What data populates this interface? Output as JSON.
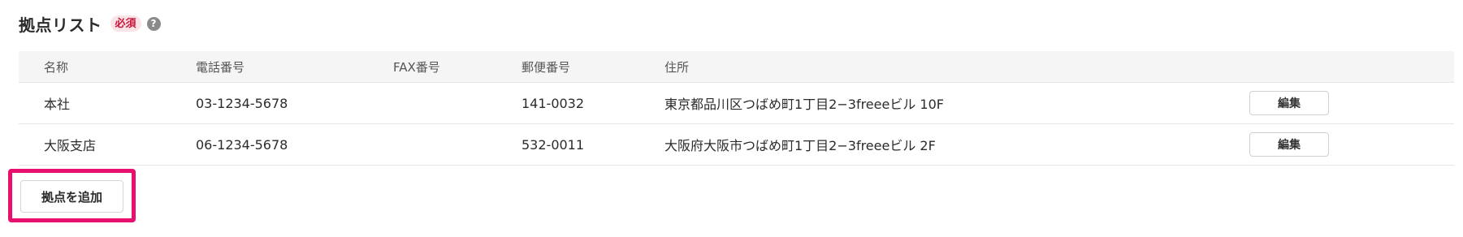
{
  "section": {
    "title": "拠点リスト",
    "required_badge": "必須",
    "help_icon": "question-circle-icon",
    "help_glyph": "?"
  },
  "table": {
    "headers": {
      "name": "名称",
      "phone": "電話番号",
      "fax": "FAX番号",
      "zip": "郵便番号",
      "address": "住所"
    },
    "rows": [
      {
        "name": "本社",
        "phone": "03-1234-5678",
        "fax": "",
        "zip": "141-0032",
        "address": "東京都品川区つばめ町1丁目2−3freeeビル 10F",
        "edit_label": "編集"
      },
      {
        "name": "大阪支店",
        "phone": "06-1234-5678",
        "fax": "",
        "zip": "532-0011",
        "address": "大阪府大阪市つばめ町1丁目2−3freeeビル 2F",
        "edit_label": "編集"
      }
    ]
  },
  "add_button": {
    "label": "拠点を追加",
    "highlight_color": "#e8106e"
  }
}
